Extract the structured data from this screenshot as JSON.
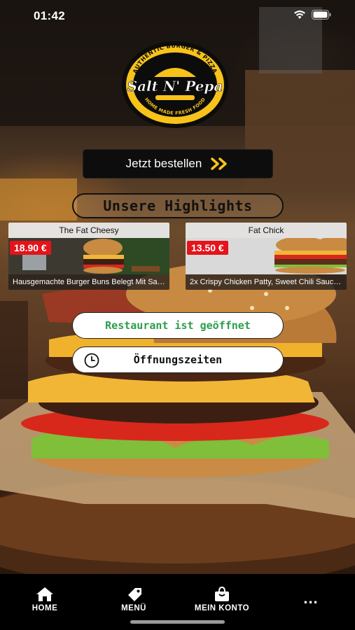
{
  "status_bar": {
    "time": "01:42"
  },
  "logo": {
    "arc_top": "AUTHENTIC BURGER & PIZZA",
    "name": "Salt N' Pepa",
    "arc_bottom": "HOME MADE FRESH FOOD"
  },
  "order_button": {
    "label": "Jetzt bestellen"
  },
  "highlights_heading": "Unsere Highlights",
  "products": [
    {
      "title": "The Fat Cheesy",
      "price": "18.90 €",
      "description": "Hausgemachte Burger Buns Belegt Mit Sal..."
    },
    {
      "title": "Fat Chick",
      "price": "13.50 €",
      "description": "2x Crispy Chicken Patty, Sweet Chili Sauce..."
    }
  ],
  "restaurant_status": "Restaurant ist geöffnet",
  "opening_hours_label": "Öffnungszeiten",
  "nav": {
    "home": "HOME",
    "menu": "MENÜ",
    "account": "MEIN KONTO",
    "more": "..."
  },
  "colors": {
    "accent": "#f7c21a",
    "price_badge": "#e3141b",
    "open_status": "#2e9d4e"
  },
  "icons": {
    "home": "home-icon",
    "menu": "tag-icon",
    "account": "shopping-bag-icon",
    "more": "more-dots-icon",
    "order": "double-chevron-right-icon",
    "hours": "clock-icon"
  }
}
